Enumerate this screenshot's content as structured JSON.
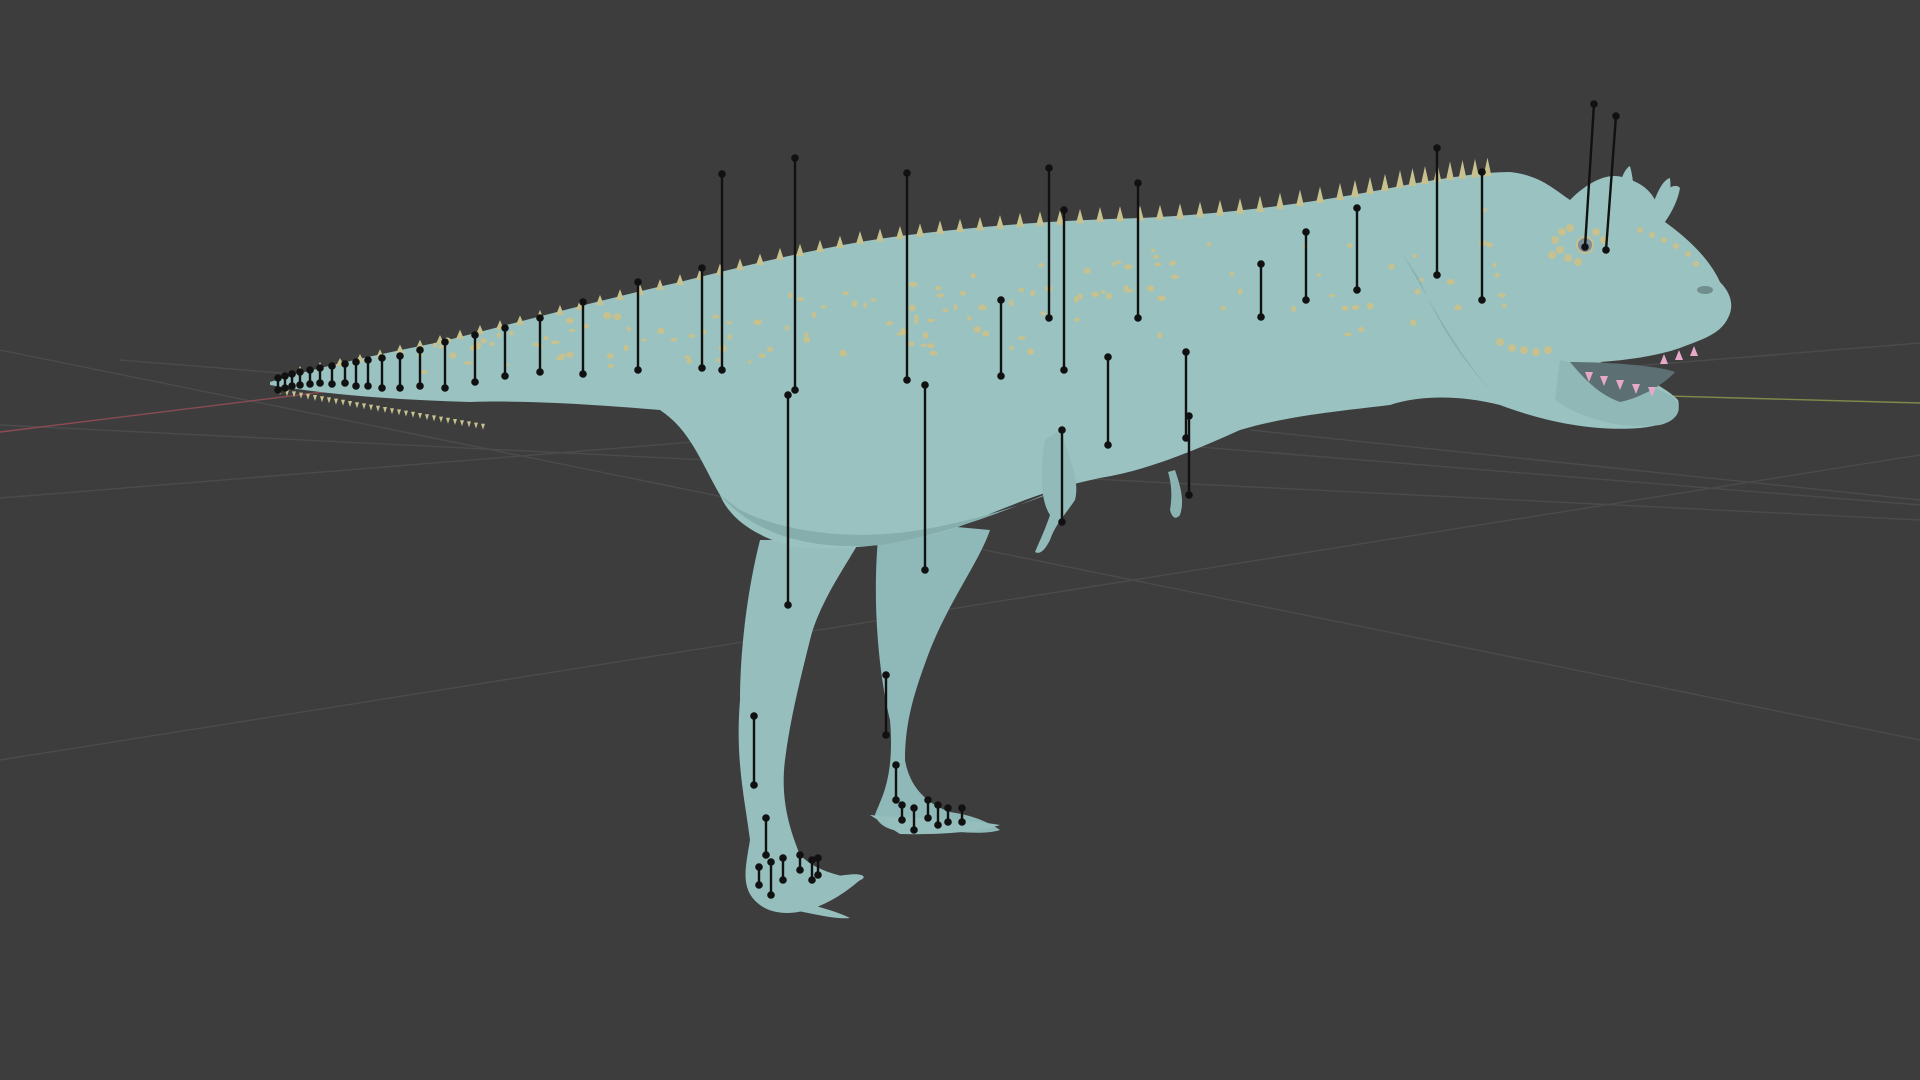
{
  "viewport": {
    "background_color": "#3d3d3d",
    "grid_color": "#4a4a4a",
    "x_axis_color": "#8a4b52",
    "y_axis_color": "#7f8a4b"
  },
  "model": {
    "body_color": "#99c2c1",
    "body_shadow_color": "#7fa8a7",
    "scale_color": "#c6c18f",
    "teeth_color": "#e7a9c9",
    "bone_color": "#111111"
  },
  "icons": [
    "3d-grid-floor",
    "dinosaur-mesh",
    "armature-bones"
  ]
}
